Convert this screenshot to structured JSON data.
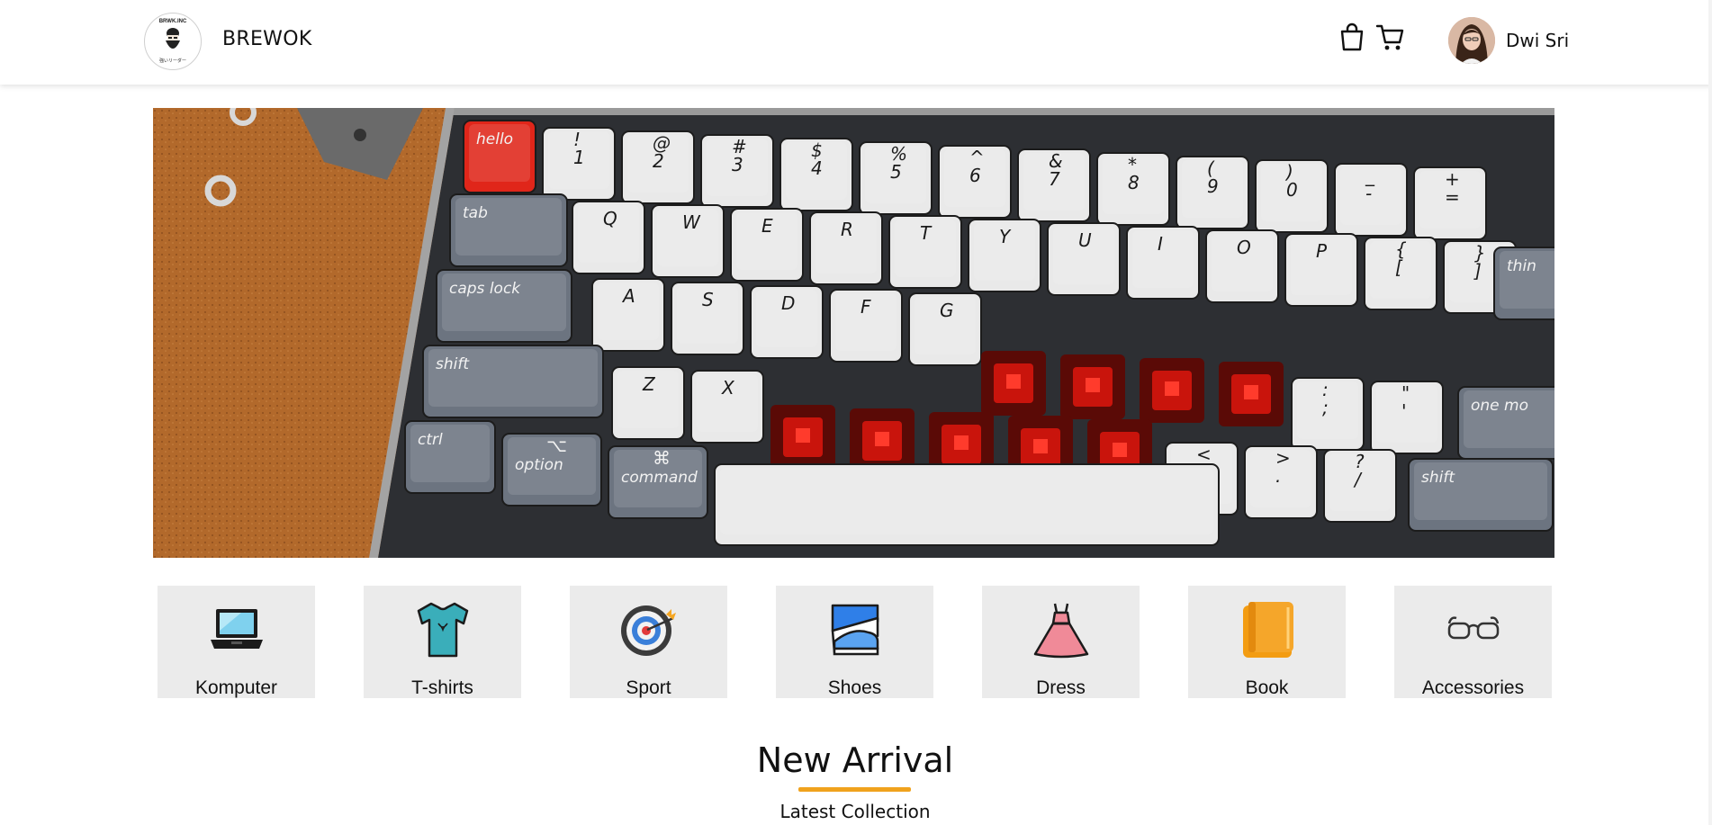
{
  "header": {
    "logo": {
      "top_text": "BRWK.INC",
      "bottom_text": "強いリーダー"
    },
    "brand": "BREWOK",
    "icons": [
      "shopping-bag-icon",
      "cart-icon"
    ],
    "user": {
      "name": "Dwi Sri"
    }
  },
  "hero": {
    "description": "mechanical keyboard banner",
    "keys": {
      "row1": [
        "hello",
        "!\n1",
        "@\n2",
        "#\n3",
        "$\n4",
        "%\n5",
        "^\n6",
        "&\n7",
        "*\n8",
        "(\n9",
        ")\n0",
        "_\n-",
        "+\n="
      ],
      "row2": [
        "tab",
        "Q",
        "W",
        "E",
        "R",
        "T",
        "Y",
        "U",
        "I",
        "O",
        "P",
        "{\n[",
        "}\n]",
        "thin"
      ],
      "row3": [
        "caps lock",
        "A",
        "S",
        "D",
        "F",
        "G",
        ":\n;",
        "\"\n'",
        "one mo"
      ],
      "row4": [
        "shift",
        "Z",
        "X",
        "<\n,",
        ">\n.",
        "?\n/",
        "shift"
      ],
      "row5": [
        "ctrl",
        "⌥\noption",
        "⌘\ncommand"
      ]
    }
  },
  "categories": [
    {
      "label": "Komputer",
      "icon": "laptop-icon"
    },
    {
      "label": "T-shirts",
      "icon": "tshirt-icon"
    },
    {
      "label": "Sport",
      "icon": "target-icon"
    },
    {
      "label": "Shoes",
      "icon": "shoes-icon"
    },
    {
      "label": "Dress",
      "icon": "dress-icon"
    },
    {
      "label": "Book",
      "icon": "book-icon"
    },
    {
      "label": "Accessories",
      "icon": "glasses-icon"
    }
  ],
  "section": {
    "title": "New Arrival",
    "subtitle": "Latest Collection"
  },
  "colors": {
    "accent": "#f0a21d",
    "category_bg": "#ebebeb",
    "hero_wood": "#b06a2c",
    "switch_red": "#c9140c"
  }
}
